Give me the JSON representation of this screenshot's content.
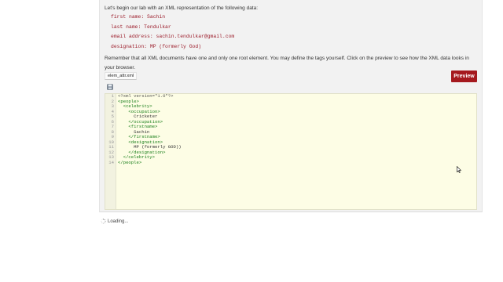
{
  "intro": "Let's begin our lab with an XML representation of the following data:",
  "fields": [
    "first name: Sachin",
    "last name: Tendulkar",
    "email address: sachin.tendulkar@gmail.com",
    "designation: MP (formerly God)"
  ],
  "remember": "Remember that all XML documents have one and only one root element. You may define the tags yourself. Click on the preview to see how the XML data looks in your browser.",
  "file_tab": "elem_attr.xml",
  "preview_label": "Preview",
  "editor": {
    "line_numbers": [
      "1",
      "2",
      "3",
      "4",
      "5",
      "6",
      "7",
      "8",
      "9",
      "10",
      "11",
      "12",
      "13",
      "14"
    ],
    "lines": [
      {
        "text": "<?xml version=\"1.0\"?>",
        "kind": "decl"
      },
      {
        "text": "<people>",
        "kind": "tag"
      },
      {
        "text": "  <celebrity>",
        "kind": "tag"
      },
      {
        "text": "    <occupation>",
        "kind": "tag"
      },
      {
        "text": "      Cricketer",
        "kind": "text"
      },
      {
        "text": "    </occupation>",
        "kind": "tag"
      },
      {
        "text": "    <firstname>",
        "kind": "tag"
      },
      {
        "text": "      Sachin",
        "kind": "text"
      },
      {
        "text": "    </firstname>",
        "kind": "tag"
      },
      {
        "text": "    <designation>",
        "kind": "tag"
      },
      {
        "text": "      MP (formerly GOD))",
        "kind": "text"
      },
      {
        "text": "    </designation>",
        "kind": "tag"
      },
      {
        "text": "  </celebrity>",
        "kind": "tag"
      },
      {
        "text": "</people>",
        "kind": "tag"
      }
    ]
  },
  "loading": "Loading...",
  "colors": {
    "accent": "#a5191e",
    "field_text": "#9c1d2b",
    "code_tag": "#1a7f1a",
    "editor_bg": "#fdfde5"
  }
}
